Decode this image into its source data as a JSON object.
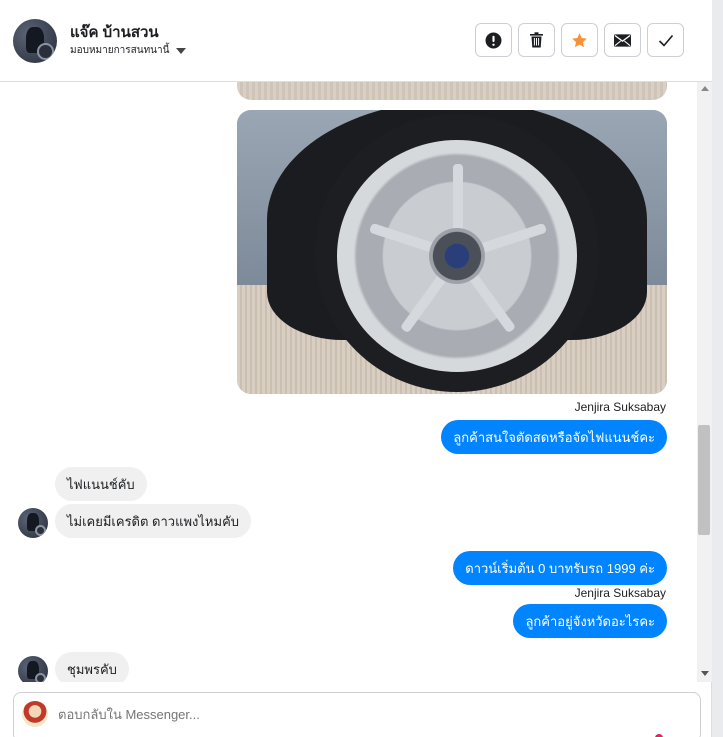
{
  "header": {
    "contact_name": "แจ๊ค บ้านสวน",
    "assign_label": "มอบหมายการสนทนานี้",
    "actions": [
      {
        "name": "report-button",
        "icon": "exclamation-circle-icon"
      },
      {
        "name": "delete-button",
        "icon": "trash-icon"
      },
      {
        "name": "star-button",
        "icon": "star-icon",
        "color": "#f7923a"
      },
      {
        "name": "mark-unread-button",
        "icon": "envelope-icon"
      },
      {
        "name": "mark-done-button",
        "icon": "check-icon"
      }
    ]
  },
  "messages": {
    "sender_1": "Jenjira Suksabay",
    "out_1": "ลูกค้าสนใจตัดสดหรือจัดไฟแนนช์คะ",
    "in_1": "ไฟแนนช์คับ",
    "in_2": "ไม่เคยมีเครดิต ดาวแพงไหมคับ",
    "out_2": "ดาวน์เริ่มต้น 0 บาทรับรถ 1999 ค่ะ",
    "sender_2": "Jenjira Suksabay",
    "out_3": "ลูกค้าอยู่จังหวัดอะไรคะ",
    "in_3": "ชุมพรคับ"
  },
  "composer": {
    "placeholder": "ตอบกลับใน Messenger..."
  },
  "colors": {
    "outgoing_bubble": "#0084ff",
    "incoming_bubble": "#f0f0f0",
    "star": "#f7923a"
  }
}
